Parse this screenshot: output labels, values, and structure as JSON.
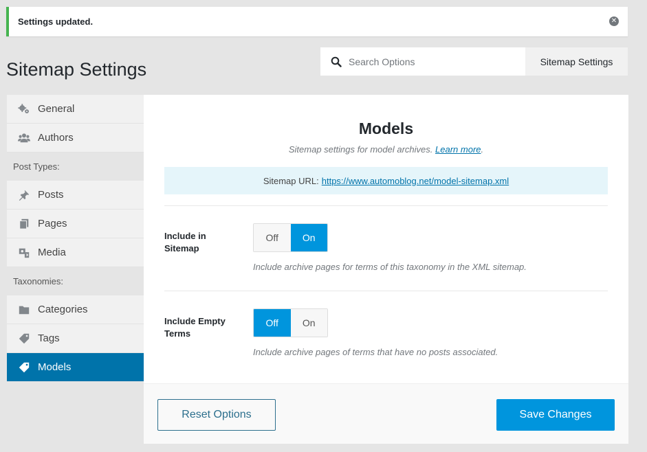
{
  "notice": {
    "text": "Settings updated.",
    "dismiss_icon": "x"
  },
  "page": {
    "title": "Sitemap Settings"
  },
  "search": {
    "placeholder": "Search Options",
    "scope_label": "Sitemap Settings"
  },
  "sidebar": {
    "top_items": [
      {
        "label": "General",
        "icon": "gears-icon"
      },
      {
        "label": "Authors",
        "icon": "users-icon"
      }
    ],
    "post_types_heading": "Post Types:",
    "post_types": [
      {
        "label": "Posts",
        "icon": "pin-icon"
      },
      {
        "label": "Pages",
        "icon": "pages-icon"
      },
      {
        "label": "Media",
        "icon": "media-icon"
      }
    ],
    "taxonomies_heading": "Taxonomies:",
    "taxonomies": [
      {
        "label": "Categories",
        "icon": "folder-icon"
      },
      {
        "label": "Tags",
        "icon": "tag-icon"
      },
      {
        "label": "Models",
        "icon": "tag-icon",
        "active": true
      }
    ]
  },
  "panel": {
    "title": "Models",
    "description": "Sitemap settings for model archives.",
    "learn_more": "Learn more",
    "desc_end": ".",
    "url_label": "Sitemap URL:",
    "url": "https://www.automoblog.net/model-sitemap.xml",
    "fields": [
      {
        "label": "Include in Sitemap",
        "off_label": "Off",
        "on_label": "On",
        "selected": "On",
        "help": "Include archive pages for terms of this taxonomy in the XML sitemap."
      },
      {
        "label": "Include Empty Terms",
        "off_label": "Off",
        "on_label": "On",
        "selected": "Off",
        "help": "Include archive pages of terms that have no posts associated."
      }
    ],
    "reset_label": "Reset Options",
    "save_label": "Save Changes"
  },
  "colors": {
    "accent": "#0095dd",
    "active_nav": "#0073aa",
    "success": "#46b450"
  }
}
